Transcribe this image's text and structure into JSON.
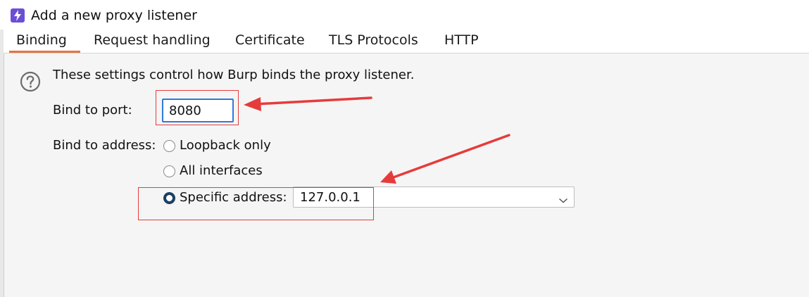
{
  "window": {
    "title": "Add a new proxy listener",
    "icon": "burp-lightning-icon"
  },
  "tabs": [
    {
      "label": "Binding",
      "active": true
    },
    {
      "label": "Request handling",
      "active": false
    },
    {
      "label": "Certificate",
      "active": false
    },
    {
      "label": "TLS Protocols",
      "active": false
    },
    {
      "label": "HTTP",
      "active": false
    }
  ],
  "binding": {
    "description": "These settings control how Burp binds the proxy listener.",
    "port_label": "Bind to port:",
    "port_value": "8080",
    "address_label": "Bind to address:",
    "options": [
      {
        "label": "Loopback only",
        "checked": false
      },
      {
        "label": "All interfaces",
        "checked": false
      },
      {
        "label": "Specific address:",
        "checked": true
      }
    ],
    "specific_address_value": "127.0.0.1"
  },
  "colors": {
    "accent_tab_underline": "#e8743c",
    "annotation_red": "#e63b3b",
    "input_focus_border": "#2f7ad8",
    "radio_selected": "#1c3f63"
  }
}
